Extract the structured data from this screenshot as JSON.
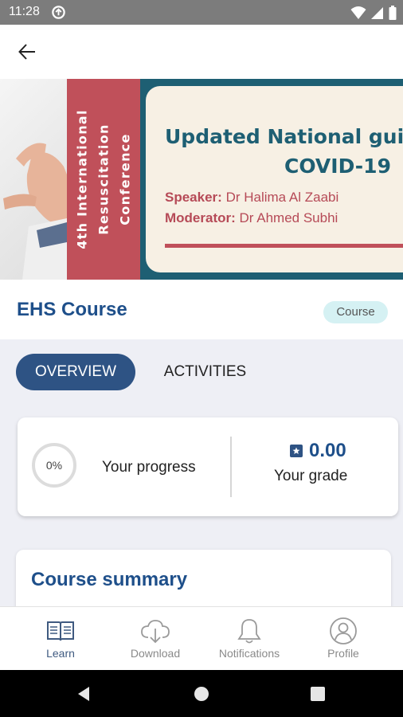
{
  "status_bar": {
    "time": "11:28"
  },
  "banner": {
    "vertical_lines": [
      "4th International",
      "Resuscitation",
      "Conference"
    ],
    "title_line1": "Updated National guid",
    "title_line2": "COVID-19",
    "speaker_label": "Speaker:",
    "speaker_name": "Dr Halima Al Zaabi",
    "moderator_label": "Moderator:",
    "moderator_name": "Dr Ahmed Subhi"
  },
  "course": {
    "title": "EHS Course",
    "chip": "Course"
  },
  "tabs": [
    {
      "label": "OVERVIEW",
      "active": true
    },
    {
      "label": "ACTIVITIES",
      "active": false
    }
  ],
  "progress": {
    "percent_text": "0%",
    "percent": 0,
    "label": "Your progress"
  },
  "grade": {
    "value": "0.00",
    "label": "Your grade"
  },
  "summary": {
    "title": "Course summary"
  },
  "bottom_nav": [
    {
      "label": "Learn",
      "icon": "book-icon",
      "active": true
    },
    {
      "label": "Download",
      "icon": "cloud-download-icon",
      "active": false
    },
    {
      "label": "Notifications",
      "icon": "bell-icon",
      "active": false
    },
    {
      "label": "Profile",
      "icon": "user-circle-icon",
      "active": false
    }
  ],
  "colors": {
    "primary": "#2e5384",
    "title_blue": "#1e4f8a",
    "banner_red": "#c0505a",
    "banner_teal": "#1e5f73",
    "chip_bg": "#d5f1f3"
  }
}
